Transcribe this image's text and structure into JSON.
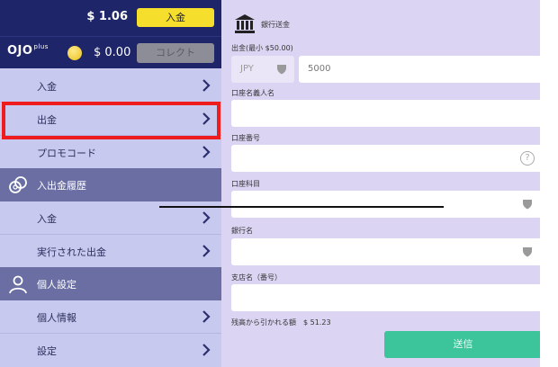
{
  "balance": {
    "amount": "$ 1.06",
    "deposit_label": "入金"
  },
  "bonus": {
    "logo_text": "OJO",
    "logo_sup": "plus",
    "amount": "$ 0.00",
    "collect_label": "コレクト"
  },
  "menu": {
    "deposit": "入金",
    "withdraw": "出金",
    "promo": "プロモコード",
    "history_section": "入出金履歴",
    "history_deposit": "入金",
    "history_withdrawals": "実行された出金",
    "personal_section": "個人設定",
    "personal_info": "個人情報",
    "settings": "設定"
  },
  "form": {
    "title": "銀行送金",
    "amount_label": "出金(最小 $50.00)",
    "currency": "JPY",
    "amount_value": "5000",
    "account_name_label": "口座名義人名",
    "account_number_label": "口座番号",
    "account_type_label": "口座科目",
    "bank_name_label": "銀行名",
    "branch_label": "支店名（番号）",
    "fee_text": "残高から引かれる額　$ 51.23",
    "submit_label": "送信",
    "help_symbol": "?"
  },
  "colors": {
    "sidebar_dark": "#1f2569",
    "sidebar_light": "#c7c9ee",
    "section_header": "#6a6ea3",
    "panel_bg": "#dcd4f3",
    "accent_yellow": "#f5de2c",
    "submit_green": "#3cc49a",
    "highlight_red": "#ee1c1c"
  },
  "icons": {
    "chevron": "chevron-right-icon",
    "history": "coins-icon",
    "personal": "user-icon",
    "bank": "bank-icon",
    "dropdown": "shield-dropdown-icon",
    "help": "question-circle-icon"
  }
}
